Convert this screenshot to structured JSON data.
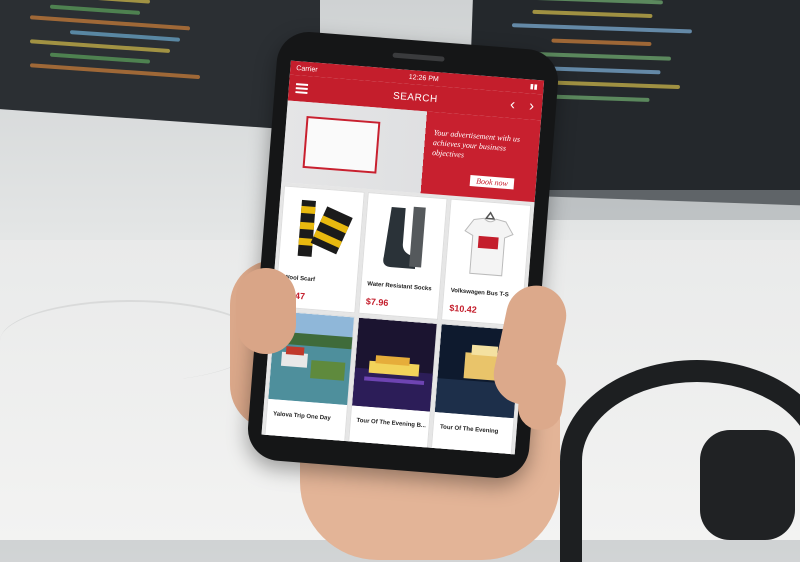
{
  "status": {
    "carrier": "Carrier",
    "time": "12:26 PM"
  },
  "header": {
    "title": "SEARCH",
    "prev_icon": "chevron-left-icon",
    "next_icon": "chevron-right-icon",
    "menu_icon": "hamburger-icon"
  },
  "banner": {
    "text": "Your advertisement with us achieves your business objectives",
    "button_label": "Book now"
  },
  "products": [
    {
      "name": "Wool Scarf",
      "price": "$9.47"
    },
    {
      "name": "Water Resistant Socks",
      "price": "$7.96"
    },
    {
      "name": "Volkswagen Bus T-S",
      "price": "$10.42"
    }
  ],
  "tours": [
    {
      "name": "Yalova Trip One Day"
    },
    {
      "name": "Tour Of The Evening B..."
    },
    {
      "name": "Tour Of The Evening"
    }
  ],
  "colors": {
    "brand": "#c41e2c",
    "screen_bg": "#f7f7f7"
  }
}
